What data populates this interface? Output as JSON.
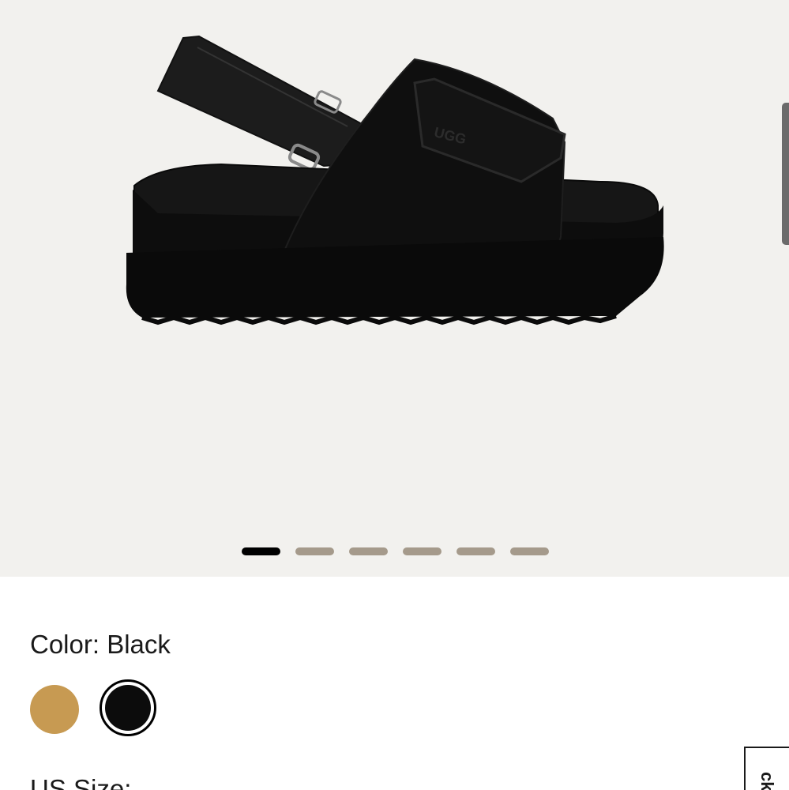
{
  "gallery": {
    "image_alt": "Black platform sandal with velcro strap and UGG logo",
    "dots_count": 6,
    "active_dot": 1
  },
  "product_image": {
    "logo_text": "UGG"
  },
  "color": {
    "label": "Color:",
    "selected": "Black",
    "options": [
      {
        "name": "Chestnut",
        "hex": "#c79a52"
      },
      {
        "name": "Black",
        "hex": "#0c0c0c"
      }
    ]
  },
  "size": {
    "label": "US Size:"
  },
  "feedback_tab": {
    "text": "ck"
  },
  "colors": {
    "gallery_bg": "#f2f1ee",
    "dot_inactive": "#a59a8b",
    "dot_active": "#000000"
  }
}
